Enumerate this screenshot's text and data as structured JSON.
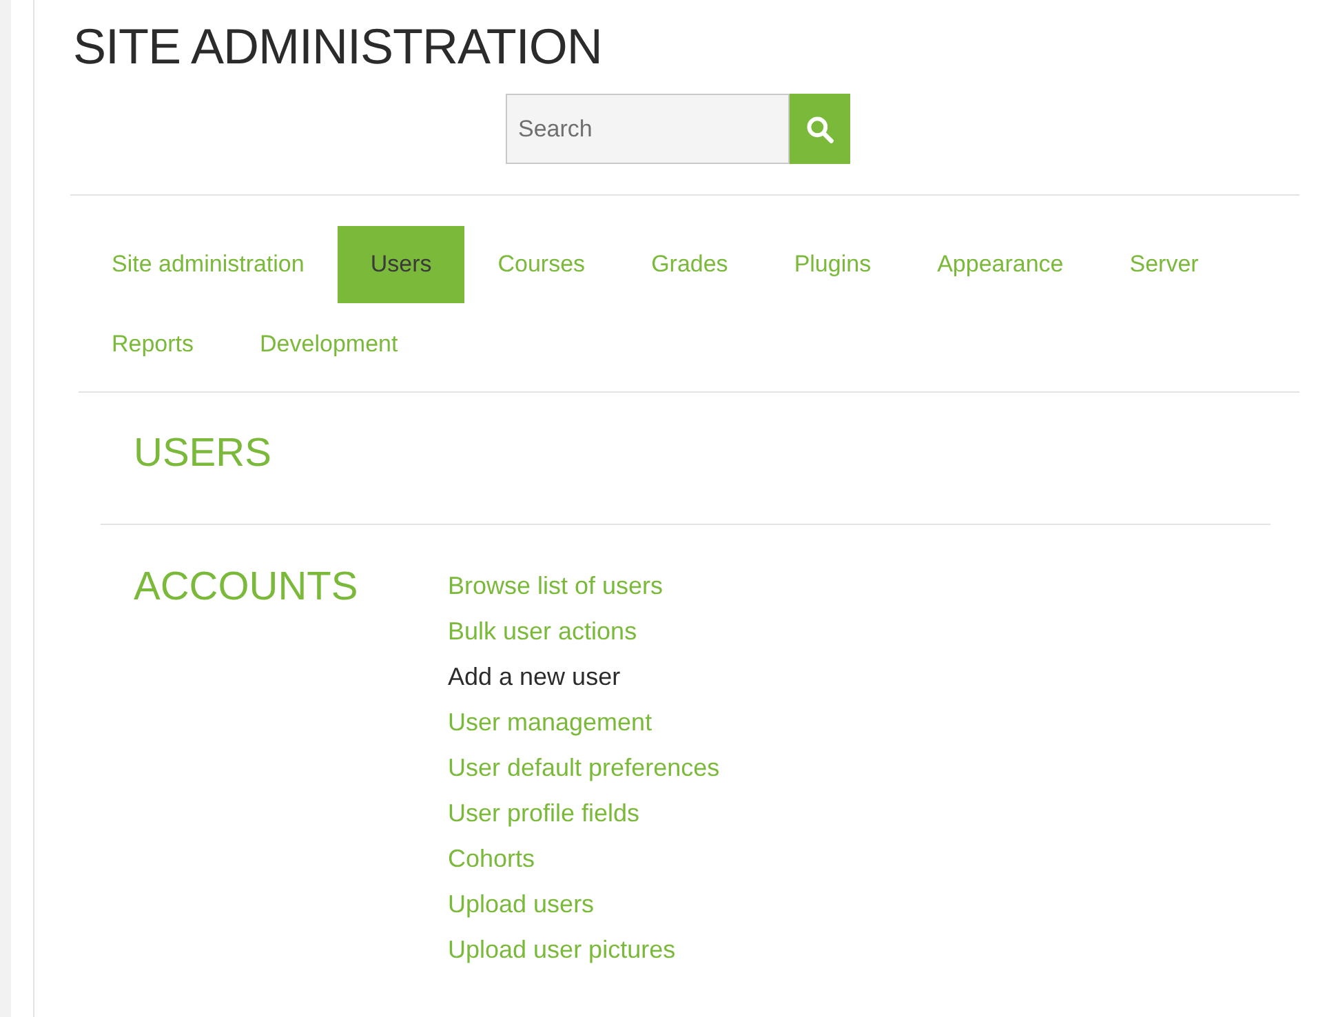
{
  "page_title": "SITE ADMINISTRATION",
  "search": {
    "placeholder": "Search"
  },
  "tabs": [
    {
      "label": "Site administration",
      "selected": false
    },
    {
      "label": "Users",
      "selected": true
    },
    {
      "label": "Courses",
      "selected": false
    },
    {
      "label": "Grades",
      "selected": false
    },
    {
      "label": "Plugins",
      "selected": false
    },
    {
      "label": "Appearance",
      "selected": false
    },
    {
      "label": "Server",
      "selected": false
    },
    {
      "label": "Reports",
      "selected": false
    },
    {
      "label": "Development",
      "selected": false
    }
  ],
  "section_heading": "USERS",
  "category": {
    "heading": "ACCOUNTS",
    "links": [
      {
        "label": "Browse list of users",
        "hovered": false
      },
      {
        "label": "Bulk user actions",
        "hovered": false
      },
      {
        "label": "Add a new user",
        "hovered": true
      },
      {
        "label": "User management",
        "hovered": false
      },
      {
        "label": "User default preferences",
        "hovered": false
      },
      {
        "label": "User profile fields",
        "hovered": false
      },
      {
        "label": "Cohorts",
        "hovered": false
      },
      {
        "label": "Upload users",
        "hovered": false
      },
      {
        "label": "Upload user pictures",
        "hovered": false
      }
    ]
  }
}
